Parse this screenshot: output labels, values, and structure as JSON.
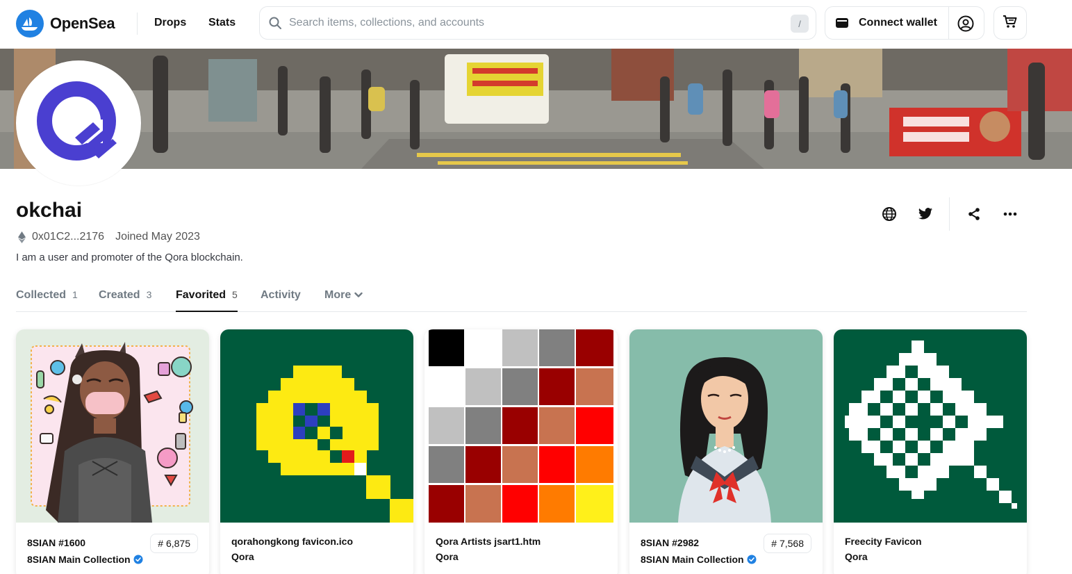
{
  "header": {
    "brand": "OpenSea",
    "nav": [
      "Drops",
      "Stats"
    ],
    "search_placeholder": "Search items, collections, and accounts",
    "search_shortcut": "/",
    "connect_wallet": "Connect wallet"
  },
  "profile": {
    "username": "okchai",
    "address": "0x01C2...2176",
    "joined": "Joined May 2023",
    "bio": "I am a user and promoter of the Qora blockchain."
  },
  "tabs": [
    {
      "label": "Collected",
      "count": "1"
    },
    {
      "label": "Created",
      "count": "3"
    },
    {
      "label": "Favorited",
      "count": "5"
    },
    {
      "label": "Activity",
      "count": ""
    },
    {
      "label": "More",
      "count": ""
    }
  ],
  "active_tab": "Favorited",
  "cards": [
    {
      "name": "8SIAN #1600",
      "collection": "8SIAN Main Collection",
      "verified": true,
      "rank": "# 6,875"
    },
    {
      "name": "qorahongkong favicon.ico",
      "collection": "Qora",
      "verified": false,
      "rank": ""
    },
    {
      "name": "Qora Artists jsart1.htm",
      "collection": "Qora",
      "verified": false,
      "rank": ""
    },
    {
      "name": "8SIAN #2982",
      "collection": "8SIAN Main Collection",
      "verified": true,
      "rank": "# 7,568"
    },
    {
      "name": "Freecity Favicon",
      "collection": "Qora",
      "verified": false,
      "rank": ""
    }
  ],
  "colors": {
    "brand_blue": "#2081E2",
    "qora_green": "#005a3c",
    "qora_yellow": "#fdea12",
    "avatar_purple": "#4a3fd0",
    "verified_blue": "#2081E2"
  },
  "icons": [
    "search-icon",
    "wallet-icon",
    "account-icon",
    "cart-icon",
    "globe-icon",
    "twitter-icon",
    "share-icon",
    "more-icon",
    "chevron-down-icon",
    "ethereum-icon",
    "verified-icon"
  ]
}
